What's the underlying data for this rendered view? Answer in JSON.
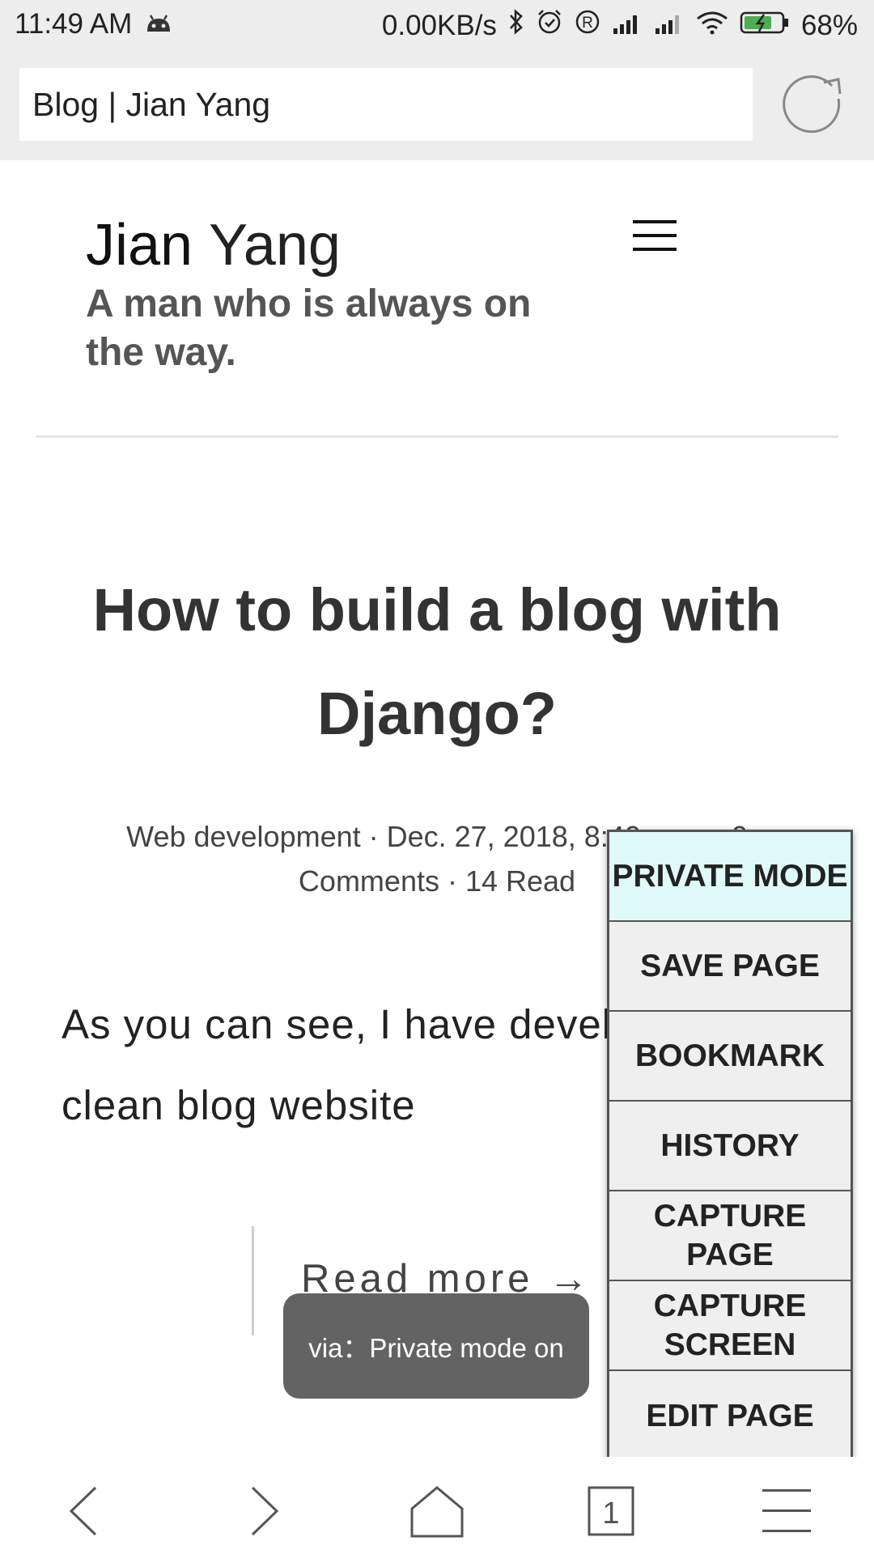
{
  "status_bar": {
    "time": "11:49 AM",
    "net_speed": "0.00KB/s",
    "battery": "68%",
    "icons": [
      "android-icon",
      "bluetooth-icon",
      "alarm-icon",
      "registered-icon",
      "signal-icon",
      "signal-icon",
      "wifi-icon",
      "battery-charging-icon"
    ]
  },
  "browser": {
    "url_title": "Blog | Jian Yang"
  },
  "page": {
    "site_first": "Jian",
    "site_last": "Yang",
    "tagline": "A man who is always on the way.",
    "post_title": "How to build a blog with Django?",
    "meta_line1": "Web development · Dec. 27, 2018, 8:40 p.m. · 0",
    "meta_line2": "Comments · 14 Read",
    "excerpt_line1": "As you can see, I have developed a",
    "excerpt_line2": "clean blog website",
    "read_more": "Read more →"
  },
  "toast": {
    "text": "via：Private mode on"
  },
  "menu": {
    "items": [
      {
        "label": "PRIVATE MODE"
      },
      {
        "label": "SAVE PAGE"
      },
      {
        "label": "BOOKMARK"
      },
      {
        "label": "HISTORY"
      },
      {
        "label": "CAPTURE PAGE"
      },
      {
        "label": "CAPTURE SCREEN"
      },
      {
        "label": "EDIT PAGE"
      }
    ]
  },
  "toolbar": {
    "tab_count": "1",
    "buttons": [
      "back-icon",
      "forward-icon",
      "home-icon",
      "tabs-icon",
      "menu-icon"
    ]
  }
}
